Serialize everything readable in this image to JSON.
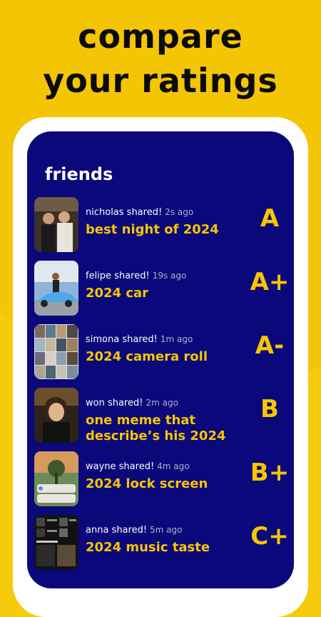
{
  "headline": {
    "line1": "compare",
    "line2": "your ratings"
  },
  "section_title": "friends",
  "colors": {
    "background": "#F6CB0C",
    "panel": "#0A087A",
    "accent": "#F7C600",
    "phone_frame": "#FFFFFF"
  },
  "items": [
    {
      "user_action": "nicholas shared!",
      "time_ago": "2s ago",
      "caption": "best night of 2024",
      "grade": "A",
      "thumbnail": "two-friends-photo"
    },
    {
      "user_action": "felipe shared!",
      "time_ago": "19s ago",
      "caption": "2024 car",
      "grade": "A+",
      "thumbnail": "car-photo"
    },
    {
      "user_action": "simona shared!",
      "time_ago": "1m ago",
      "caption": "2024 camera roll",
      "grade": "A-",
      "thumbnail": "camera-roll-grid"
    },
    {
      "user_action": "won shared!",
      "time_ago": "2m ago",
      "caption": "one meme that describe’s his 2024",
      "grade": "B",
      "thumbnail": "meme-photo"
    },
    {
      "user_action": "wayne shared!",
      "time_ago": "4m ago",
      "caption": "2024 lock screen",
      "grade": "B+",
      "thumbnail": "lock-screen"
    },
    {
      "user_action": "anna shared!",
      "time_ago": "5m ago",
      "caption": "2024 music taste",
      "grade": "C+",
      "thumbnail": "music-app-screenshot"
    }
  ]
}
